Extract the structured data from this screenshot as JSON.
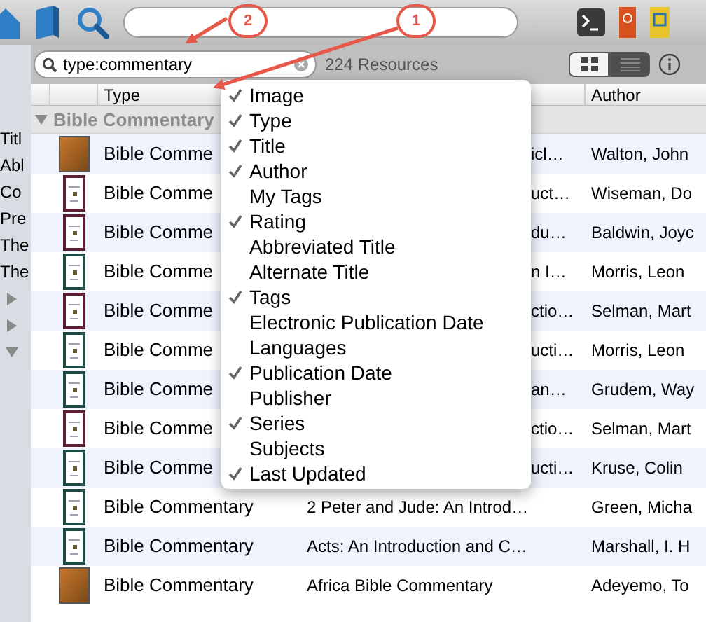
{
  "library": {
    "search": {
      "value": "type:commentary"
    },
    "count": "224 Resources",
    "views": [
      {
        "kind": "grid",
        "selected": false
      },
      {
        "kind": "list",
        "selected": true
      }
    ]
  },
  "sidebar": {
    "items": [
      "Titl",
      "Abl",
      "Co",
      "Pre",
      "The",
      "The"
    ],
    "folders": [
      {
        "expanded": false
      },
      {
        "expanded": false
      },
      {
        "expanded": true
      }
    ]
  },
  "table": {
    "columns": [
      "Type",
      "Author"
    ],
    "group": {
      "label": "Bible Commentary",
      "expanded": true
    },
    "rows": [
      {
        "cover": {
          "kind": "photo"
        },
        "type": "Bible Comme",
        "title": "icl…",
        "under_menu": true,
        "author": "Walton, John"
      },
      {
        "cover": {
          "kind": "book",
          "color": "#5a1f35"
        },
        "type": "Bible Comme",
        "title": "uct…",
        "under_menu": true,
        "author": "Wiseman, Do"
      },
      {
        "cover": {
          "kind": "book",
          "color": "#5a1f35"
        },
        "type": "Bible Comme",
        "title": "du…",
        "under_menu": true,
        "author": "Baldwin, Joyc"
      },
      {
        "cover": {
          "kind": "book",
          "color": "#1f4a43"
        },
        "type": "Bible Comme",
        "title": "n I…",
        "under_menu": true,
        "author": "Morris, Leon"
      },
      {
        "cover": {
          "kind": "book",
          "color": "#5a1f35"
        },
        "type": "Bible Comme",
        "title": "ctio…",
        "under_menu": true,
        "author": "Selman, Mart"
      },
      {
        "cover": {
          "kind": "book",
          "color": "#1f4a43"
        },
        "type": "Bible Comme",
        "title": "ucti…",
        "under_menu": true,
        "author": "Morris, Leon"
      },
      {
        "cover": {
          "kind": "book",
          "color": "#1f4a43"
        },
        "type": "Bible Comme",
        "title": "an…",
        "under_menu": true,
        "author": "Grudem, Way"
      },
      {
        "cover": {
          "kind": "book",
          "color": "#5a1f35"
        },
        "type": "Bible Comme",
        "title": "ctio…",
        "under_menu": true,
        "author": "Selman, Mart"
      },
      {
        "cover": {
          "kind": "book",
          "color": "#1f4a43"
        },
        "type": "Bible Comme",
        "title": "ucti…",
        "under_menu": true,
        "author": "Kruse, Colin"
      },
      {
        "cover": {
          "kind": "book",
          "color": "#1f4a43"
        },
        "type": "Bible Commentary",
        "title": "2 Peter and Jude: An Introd…",
        "under_menu": false,
        "author": "Green, Micha"
      },
      {
        "cover": {
          "kind": "book",
          "color": "#1f4a43"
        },
        "type": "Bible Commentary",
        "title": "Acts: An Introduction and C…",
        "under_menu": false,
        "author": "Marshall, I. H"
      },
      {
        "cover": {
          "kind": "photo"
        },
        "type": "Bible Commentary",
        "title": "Africa Bible Commentary",
        "under_menu": false,
        "author": "Adeyemo, To"
      }
    ]
  },
  "column_menu": [
    {
      "label": "Image",
      "checked": true
    },
    {
      "label": "Type",
      "checked": true
    },
    {
      "label": "Title",
      "checked": true
    },
    {
      "label": "Author",
      "checked": true
    },
    {
      "label": "My Tags",
      "checked": false
    },
    {
      "label": "Rating",
      "checked": true
    },
    {
      "label": "Abbreviated Title",
      "checked": false
    },
    {
      "label": "Alternate Title",
      "checked": false
    },
    {
      "label": "Tags",
      "checked": true
    },
    {
      "label": "Electronic Publication Date",
      "checked": false
    },
    {
      "label": "Languages",
      "checked": false
    },
    {
      "label": "Publication Date",
      "checked": true
    },
    {
      "label": "Publisher",
      "checked": false
    },
    {
      "label": "Series",
      "checked": true
    },
    {
      "label": "Subjects",
      "checked": false
    },
    {
      "label": "Last Updated",
      "checked": true
    }
  ],
  "annotations": [
    {
      "label": "2"
    },
    {
      "label": "1"
    }
  ]
}
